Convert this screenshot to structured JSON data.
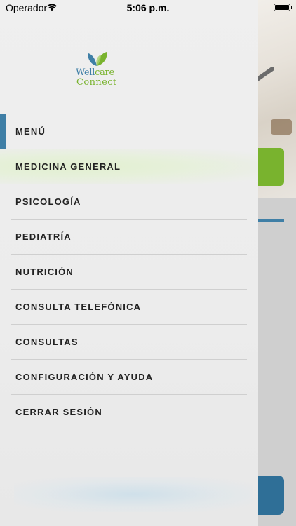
{
  "status_bar": {
    "carrier": "Operador",
    "time": "5:06 p.m."
  },
  "logo": {
    "word1_part1": "Well",
    "word1_part2": "care",
    "word2": "Connect"
  },
  "colors": {
    "brand_blue": "#3f7fa6",
    "brand_green": "#79b32e"
  },
  "menu": {
    "items": [
      {
        "label": "MENÚ"
      },
      {
        "label": "MEDICINA GENERAL"
      },
      {
        "label": "PSICOLOGÍA"
      },
      {
        "label": "PEDIATRÍA"
      },
      {
        "label": "NUTRICIÓN"
      },
      {
        "label": "CONSULTA TELEFÓNICA"
      },
      {
        "label": "CONSULTAS"
      },
      {
        "label": "CONFIGURACIÓN Y AYUDA"
      },
      {
        "label": "CERRAR SESIÓN"
      }
    ]
  }
}
